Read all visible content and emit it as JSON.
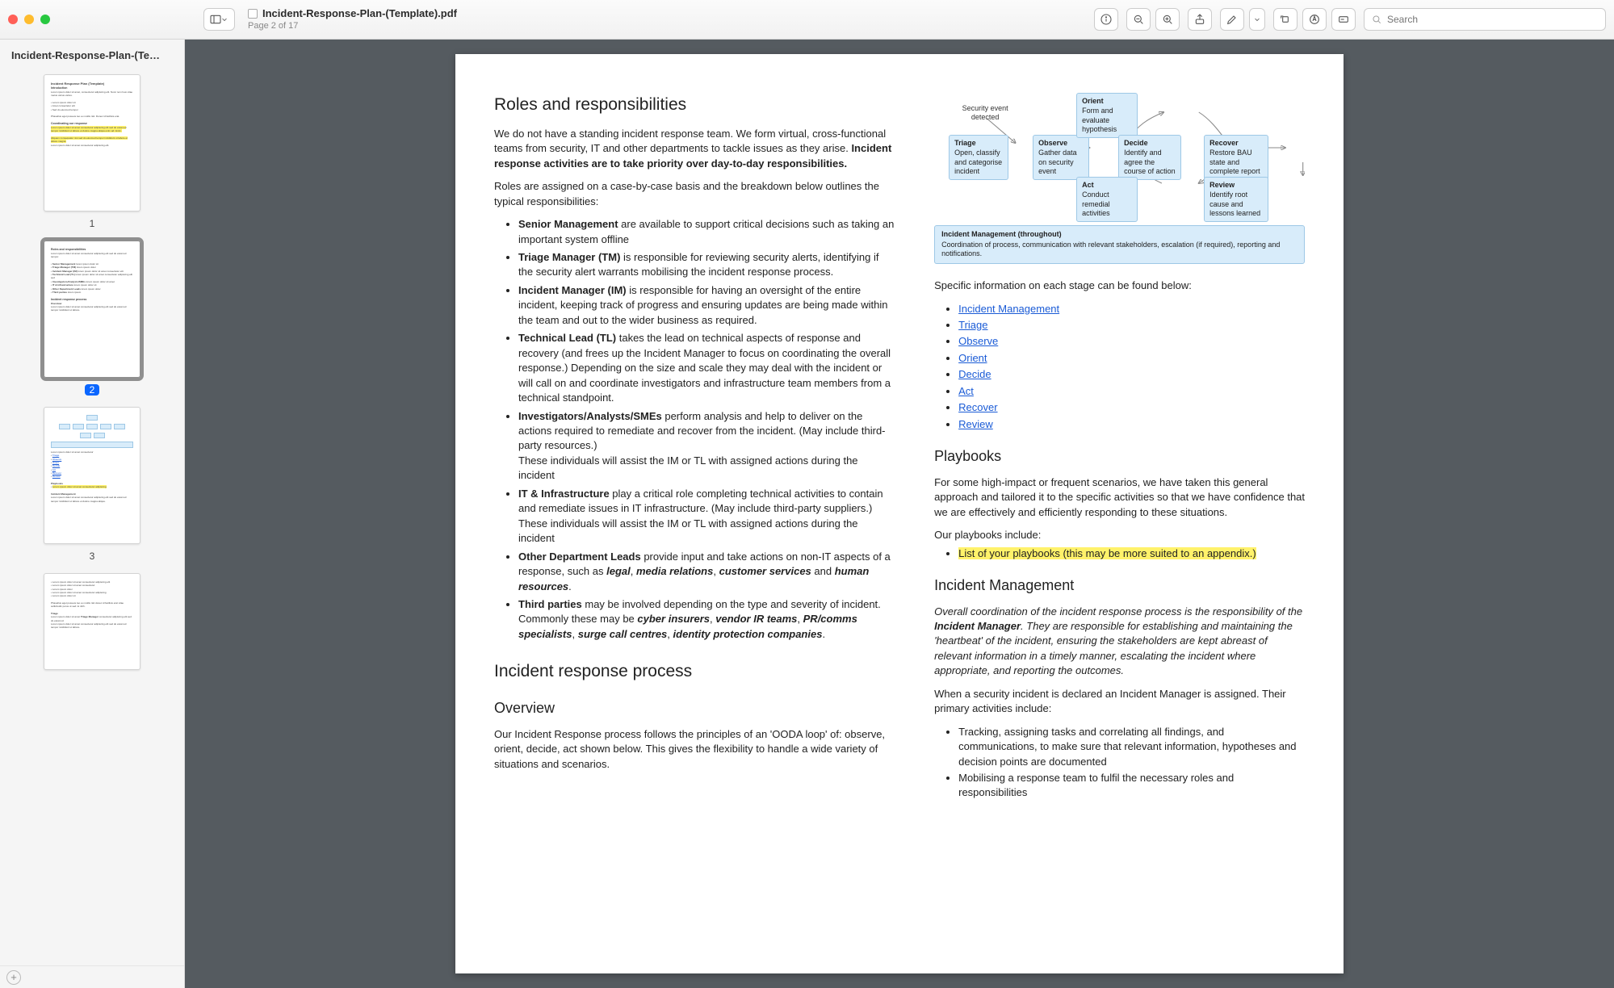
{
  "window": {
    "filename": "Incident-Response-Plan-(Template).pdf",
    "page_label": "Page 2 of 17",
    "sidebar_title": "Incident-Response-Plan-(Te…",
    "search_placeholder": "Search"
  },
  "thumbs": {
    "n1": "1",
    "n2": "2",
    "n3": "3"
  },
  "doc": {
    "h_roles": "Roles and responsibilities",
    "p_roles_intro_a": "We do not have a standing incident response team. We form virtual, cross-functional teams from security, IT and other departments to tackle issues as they arise. ",
    "p_roles_intro_b": "Incident response activities are to take priority over day-to-day responsibilities.",
    "p_roles_assigned": "Roles are assigned on a case-by-case basis and the breakdown below outlines the typical responsibilities:",
    "roles": {
      "sm_b": "Senior Management",
      "sm_t": " are available to support critical decisions such as taking an important system offline",
      "tm_b": "Triage Manager (TM)",
      "tm_t": " is responsible for reviewing security alerts, identifying if the security alert warrants mobilising the incident response process.",
      "im_b": "Incident Manager (IM)",
      "im_t": " is responsible for having an oversight of the entire incident, keeping track of progress and ensuring updates are being made within the team and out to the wider business as required.",
      "tl_b": "Technical Lead (TL)",
      "tl_t": " takes the lead on technical aspects of response and recovery (and frees up the Incident Manager to focus on coordinating the overall response.) Depending on the size and scale they may deal with the incident or will call on and coordinate investigators and infrastructure team members from a technical standpoint.",
      "inv_b": "Investigators/Analysts/SMEs",
      "inv_t": " perform analysis and help to deliver on the actions required to remediate and recover from the incident. (May include third-party resources.)",
      "inv_t2": "These individuals will assist the IM or TL with assigned actions during the incident",
      "it_b": "IT & Infrastructure",
      "it_t": " play a critical role completing technical activities to contain and remediate issues in IT infrastructure. (May include third-party suppliers.)",
      "it_t2": "These individuals will assist the IM or TL with assigned actions during the incident",
      "od_b": "Other Department Leads",
      "od_t1": " provide input and take actions on non-IT aspects of a response, such as ",
      "od_i1": "legal",
      "od_c1": ", ",
      "od_i2": "media relations",
      "od_c2": ", ",
      "od_i3": "customer services",
      "od_c3": " and ",
      "od_i4": "human resources",
      "od_c4": ".",
      "tp_b": "Third parties",
      "tp_t1": " may be involved depending on the type and severity of incident. Commonly these may be ",
      "tp_i1": "cyber insurers",
      "tp_c1": ", ",
      "tp_i2": "vendor IR teams",
      "tp_c2": ", ",
      "tp_i3": "PR/comms specialists",
      "tp_c3": ", ",
      "tp_i4": "surge call centres",
      "tp_c4": ", ",
      "tp_i5": "identity protection companies",
      "tp_c5": "."
    },
    "h_process": "Incident response process",
    "h_overview": "Overview",
    "p_overview": "Our Incident Response process follows the principles of an 'OODA loop' of: observe, orient, decide, act shown below. This gives the flexibility to handle a wide variety of situations and scenarios.",
    "diagram": {
      "sec_event": "Security event detected",
      "triage_b": "Triage",
      "triage_t": "Open, classify and categorise incident",
      "observe_b": "Observe",
      "observe_t": "Gather data on security event",
      "orient_b": "Orient",
      "orient_t": "Form and evaluate hypothesis",
      "decide_b": "Decide",
      "decide_t": "Identify and agree the course of action",
      "act_b": "Act",
      "act_t": "Conduct remedial activities",
      "recover_b": "Recover",
      "recover_t": "Restore BAU state and complete report",
      "review_b": "Review",
      "review_t": "Identify root cause and lessons learned",
      "wide_b": "Incident Management (throughout)",
      "wide_t": "Coordination of process, communication with relevant stakeholders, escalation (if required), reporting and notifications."
    },
    "p_stages_intro": "Specific information on each stage can be found below:",
    "stages": {
      "s1": "Incident Management",
      "s2": "Triage",
      "s3": "Observe",
      "s4": "Orient",
      "s5": "Decide",
      "s6": "Act",
      "s7": "Recover",
      "s8": "Review"
    },
    "h_playbooks": "Playbooks",
    "p_playbooks": "For some high-impact or frequent scenarios, we have taken this general approach and tailored it to the specific activities so that we have confidence that we are effectively and efficiently responding to these situations.",
    "p_playbooks_inc": "Our playbooks include:",
    "playbook_item": "List of your playbooks (this may be more suited to an appendix.)",
    "h_im": "Incident Management",
    "p_im_it_a": "Overall coordination of the incident response process is the responsibility of the ",
    "p_im_it_b": "Incident Manager",
    "p_im_it_c": ". They are responsible for establishing and maintaining the 'heartbeat' of the incident,  ensuring the stakeholders are kept abreast of relevant information in a timely manner, escalating the incident where appropriate, and reporting the outcomes.",
    "p_im2": "When a security incident is declared an Incident Manager is assigned. Their primary activities include:",
    "im_list": {
      "a": "Tracking, assigning tasks and correlating all findings, and communications, to make sure that relevant information, hypotheses and decision points are documented",
      "b": "Mobilising a response team to fulfil the necessary roles and responsibilities"
    }
  }
}
